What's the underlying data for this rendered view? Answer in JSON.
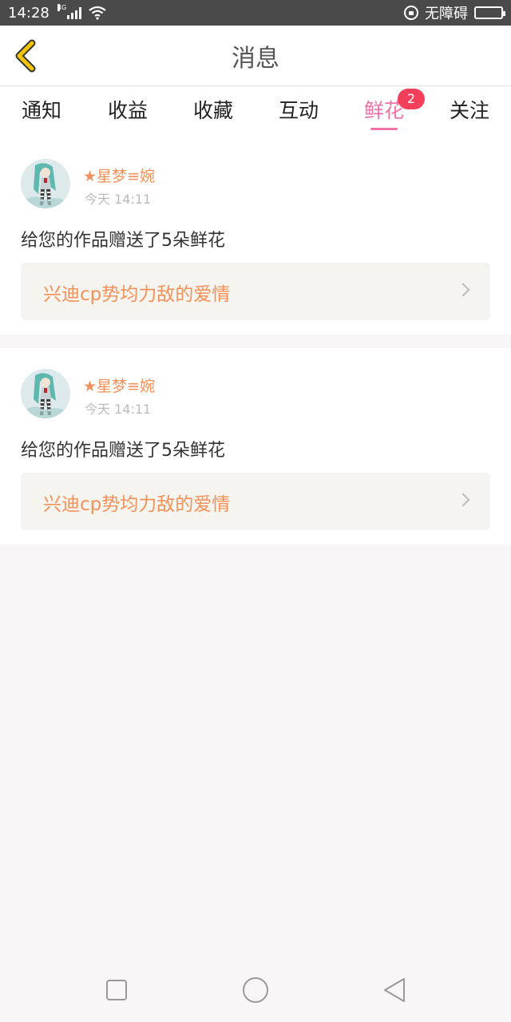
{
  "status_bar": {
    "time": "14:28",
    "network": "4G",
    "accessibility": "无障碍",
    "icons": [
      "signal-icon",
      "wifi-icon",
      "lock-icon",
      "battery-icon"
    ]
  },
  "header": {
    "title": "消息",
    "back_icon": "chevron-left-icon",
    "back_color": "#f5c400"
  },
  "tabs": [
    {
      "label": "通知",
      "active": false
    },
    {
      "label": "收益",
      "active": false
    },
    {
      "label": "收藏",
      "active": false
    },
    {
      "label": "互动",
      "active": false
    },
    {
      "label": "鲜花",
      "active": true,
      "badge": "2"
    },
    {
      "label": "关注",
      "active": false
    }
  ],
  "messages": [
    {
      "username": "★星梦≡婉",
      "time": "今天 14:11",
      "text": "给您的作品赠送了5朵鲜花",
      "work_title": "兴迪cp势均力敌的爱情"
    },
    {
      "username": "★星梦≡婉",
      "time": "今天 14:11",
      "text": "给您的作品赠送了5朵鲜花",
      "work_title": "兴迪cp势均力敌的爱情"
    }
  ],
  "nav": {
    "icons": [
      "square-icon",
      "circle-icon",
      "triangle-back-icon"
    ]
  },
  "colors": {
    "accent": "#f072a8",
    "badge": "#f2405a",
    "username": "#f4915a",
    "link_bg": "#f5f4ee"
  }
}
